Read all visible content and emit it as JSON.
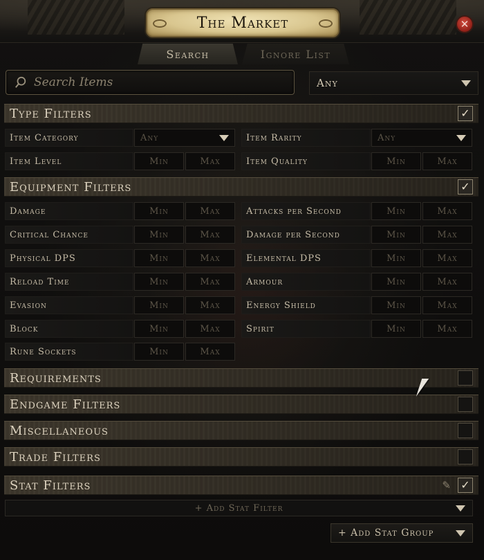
{
  "window": {
    "title": "The Market",
    "close_glyph": "✕"
  },
  "tabs": [
    {
      "label": "Search",
      "active": true
    },
    {
      "label": "Ignore List",
      "active": false
    }
  ],
  "search": {
    "placeholder": "Search Items",
    "value": "",
    "status_select": "Any"
  },
  "sections": {
    "type_filters": {
      "title": "Type Filters",
      "checked": true,
      "item_category": {
        "label": "Item Category",
        "value": "Any"
      },
      "item_rarity": {
        "label": "Item Rarity",
        "value": "Any"
      },
      "item_level": {
        "label": "Item Level"
      },
      "item_quality": {
        "label": "Item Quality"
      }
    },
    "equipment_filters": {
      "title": "Equipment Filters",
      "checked": true,
      "left": [
        {
          "label": "Damage"
        },
        {
          "label": "Critical Chance"
        },
        {
          "label": "Physical DPS"
        },
        {
          "label": "Reload Time"
        },
        {
          "label": "Evasion"
        },
        {
          "label": "Block"
        },
        {
          "label": "Rune Sockets"
        }
      ],
      "right": [
        {
          "label": "Attacks per Second"
        },
        {
          "label": "Damage per Second"
        },
        {
          "label": "Elemental DPS"
        },
        {
          "label": "Armour"
        },
        {
          "label": "Energy Shield"
        },
        {
          "label": "Spirit"
        }
      ]
    },
    "requirements": {
      "title": "Requirements",
      "checked": false
    },
    "endgame_filters": {
      "title": "Endgame Filters",
      "checked": false
    },
    "miscellaneous": {
      "title": "Miscellaneous",
      "checked": false
    },
    "trade_filters": {
      "title": "Trade Filters",
      "checked": false
    },
    "stat_filters": {
      "title": "Stat Filters",
      "checked": true
    }
  },
  "placeholders": {
    "min": "Min",
    "max": "Max"
  },
  "add_stat_filter": "+ Add Stat Filter",
  "add_stat_group": "+ Add Stat Group",
  "colors": {
    "accent_gold": "#d9c68f",
    "close_red": "#b8372b",
    "text": "#c6bca7",
    "background": "#0c0b0a"
  },
  "icons": {
    "search": "search-icon",
    "close": "close-icon",
    "check": "check-icon",
    "pencil": "pencil-icon",
    "caret": "chevron-down-icon"
  },
  "glyphs": {
    "check": "✓",
    "pencil": "✎"
  }
}
